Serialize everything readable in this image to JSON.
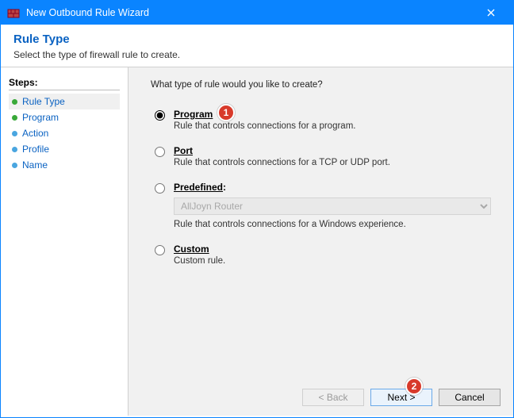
{
  "window": {
    "title": "New Outbound Rule Wizard"
  },
  "header": {
    "title": "Rule Type",
    "subtitle": "Select the type of firewall rule to create."
  },
  "sidebar": {
    "label": "Steps:",
    "items": [
      {
        "label": "Rule Type",
        "active": true,
        "bullet": "green"
      },
      {
        "label": "Program",
        "active": false,
        "bullet": "green"
      },
      {
        "label": "Action",
        "active": false,
        "bullet": "blue"
      },
      {
        "label": "Profile",
        "active": false,
        "bullet": "blue"
      },
      {
        "label": "Name",
        "active": false,
        "bullet": "blue"
      }
    ]
  },
  "content": {
    "question": "What type of rule would you like to create?",
    "options": {
      "program": {
        "label": "Program",
        "desc": "Rule that controls connections for a program.",
        "selected": true
      },
      "port": {
        "label": "Port",
        "desc": "Rule that controls connections for a TCP or UDP port.",
        "selected": false
      },
      "predefined": {
        "label": "Predefined",
        "colon": ":",
        "select_value": "AllJoyn Router",
        "desc": "Rule that controls connections for a Windows experience.",
        "selected": false
      },
      "custom": {
        "label": "Custom",
        "desc": "Custom rule.",
        "selected": false
      }
    }
  },
  "footer": {
    "back": "< Back",
    "next": "Next >",
    "cancel": "Cancel"
  },
  "annotations": {
    "badge1": "1",
    "badge2": "2"
  }
}
